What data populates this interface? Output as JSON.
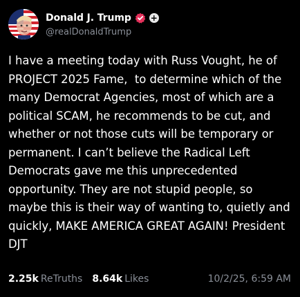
{
  "author": {
    "display_name": "Donald J. Trump",
    "handle": "@realDonaldTrump",
    "verified_icon": "verified-badge-icon",
    "plus_label": "+",
    "badge_color": "#e5315b"
  },
  "post": {
    "text": "I have a meeting today with Russ Vought, he of PROJECT 2025 Fame,  to determine which of the many Democrat Agencies, most of which are a political SCAM, he recommends to be cut, and whether or not those cuts will be temporary or permanent. I can’t believe the Radical Left Democrats gave me this unprecedented opportunity. They are not stupid people, so maybe this is their way of wanting to, quietly and quickly, MAKE AMERICA GREAT AGAIN! President DJT"
  },
  "stats": {
    "retruths_count": "2.25k",
    "retruths_label": "ReTruths",
    "likes_count": "8.64k",
    "likes_label": "Likes",
    "timestamp": "10/2/25, 6:59 AM"
  }
}
